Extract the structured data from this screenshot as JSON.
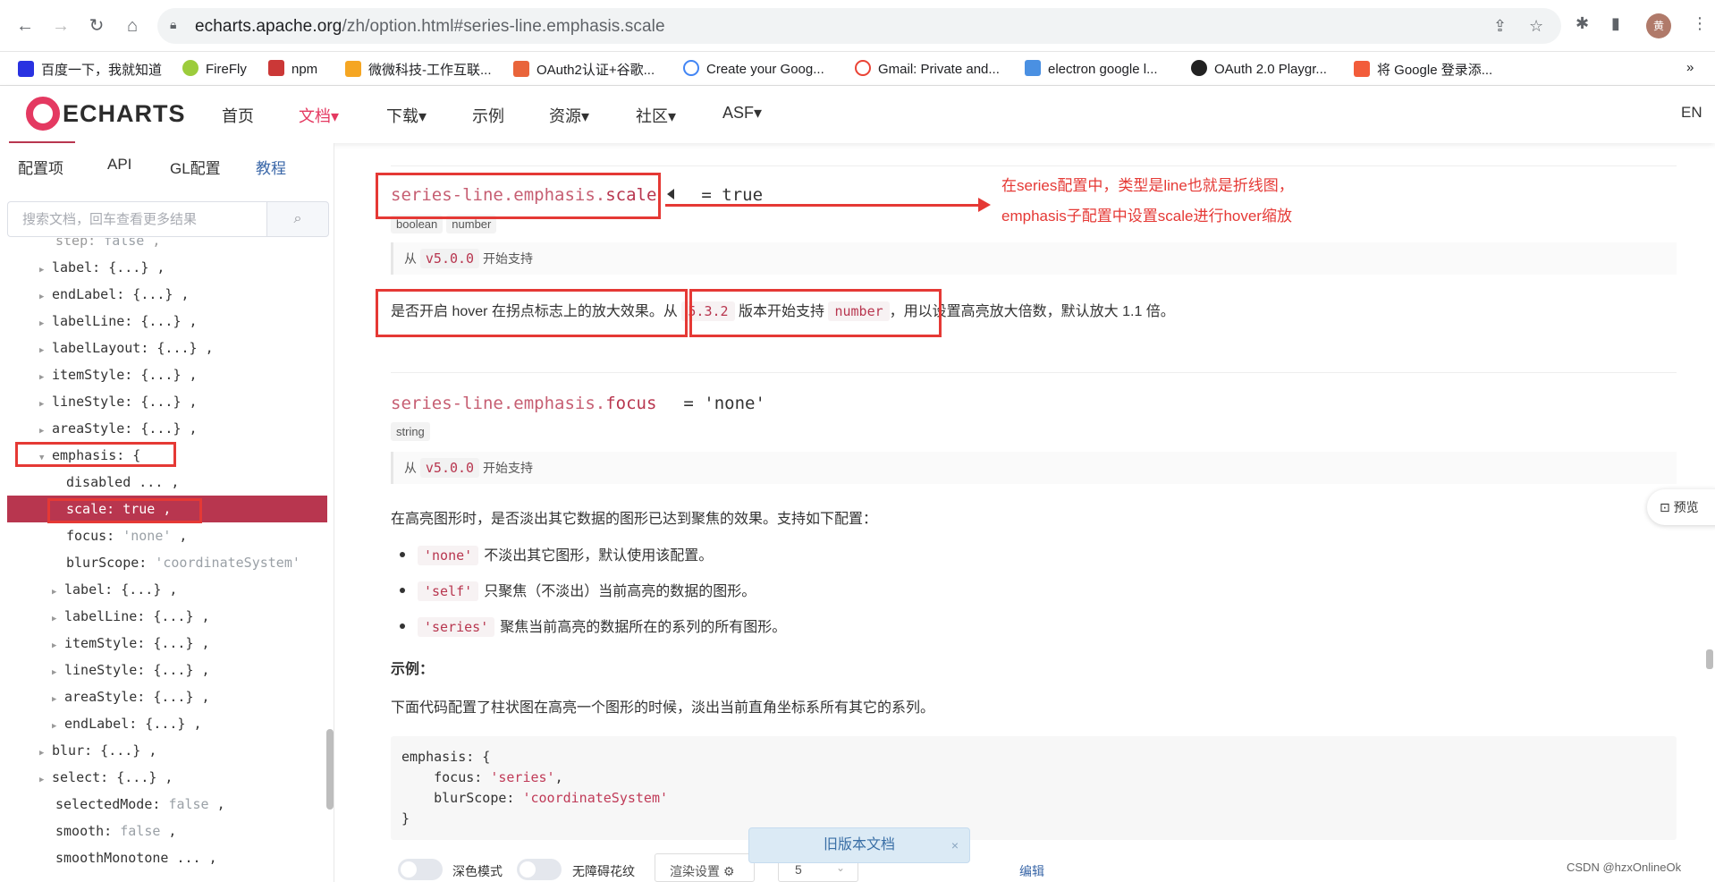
{
  "browser": {
    "url_host": "echarts.apache.org",
    "url_path": "/zh/option.html#series-line.emphasis.scale",
    "avatar_text": "黄",
    "bookmarks": [
      "百度一下，我就知道",
      "FireFly",
      "npm",
      "微微科技-工作互联...",
      "OAuth2认证+谷歌...",
      "Create your Goog...",
      "Gmail: Private and...",
      "electron google l...",
      "OAuth 2.0 Playgr...",
      "将 Google 登录添..."
    ],
    "bookmarks_more": "»"
  },
  "site": {
    "logo": "ECHARTS",
    "menu": [
      "首页",
      "文档▾",
      "下载▾",
      "示例",
      "资源▾",
      "社区▾",
      "ASF▾"
    ],
    "lang": "EN"
  },
  "sidebar": {
    "tabs": [
      "配置项",
      "API",
      "GL配置",
      "教程"
    ],
    "search_placeholder": "搜索文档，回车查看更多结果",
    "tree": [
      {
        "key": "step:",
        "val": "false",
        "tail": " ,"
      },
      {
        "key": "label:",
        "val": "",
        "tail": " {...} ,"
      },
      {
        "key": "endLabel:",
        "val": "",
        "tail": " {...} ,"
      },
      {
        "key": "labelLine:",
        "val": "",
        "tail": " {...} ,"
      },
      {
        "key": "labelLayout:",
        "val": "",
        "tail": " {...} ,"
      },
      {
        "key": "itemStyle:",
        "val": "",
        "tail": " {...} ,"
      },
      {
        "key": "lineStyle:",
        "val": "",
        "tail": " {...} ,"
      },
      {
        "key": "areaStyle:",
        "val": "",
        "tail": " {...} ,"
      },
      {
        "key": "emphasis:",
        "val": "",
        "tail": " {"
      },
      {
        "key": "disabled",
        "val": "",
        "tail": " ... ,"
      },
      {
        "key": "scale:",
        "val": "",
        "tail": " true ,"
      },
      {
        "key": "focus:",
        "val": "'none'",
        "tail": " ,"
      },
      {
        "key": "blurScope:",
        "val": "'coordinateSystem'",
        "tail": ""
      },
      {
        "key": "label:",
        "val": "",
        "tail": " {...} ,"
      },
      {
        "key": "labelLine:",
        "val": "",
        "tail": " {...} ,"
      },
      {
        "key": "itemStyle:",
        "val": "",
        "tail": " {...} ,"
      },
      {
        "key": "lineStyle:",
        "val": "",
        "tail": " {...} ,"
      },
      {
        "key": "areaStyle:",
        "val": "",
        "tail": " {...} ,"
      },
      {
        "key": "endLabel:",
        "val": "",
        "tail": " {...} ,"
      },
      {
        "key": "blur:",
        "val": "",
        "tail": " {...} ,"
      },
      {
        "key": "select:",
        "val": "",
        "tail": " {...} ,"
      },
      {
        "key": "selectedMode:",
        "val": "false",
        "tail": " ,"
      },
      {
        "key": "smooth:",
        "val": "false",
        "tail": " ,"
      },
      {
        "key": "smoothMonotone",
        "val": "",
        "tail": " ... ,"
      }
    ]
  },
  "scale_option": {
    "prefix": "series-line.emphasis.",
    "name": "scale",
    "default": "= true",
    "types": [
      "boolean",
      "number"
    ],
    "since_label": "从",
    "since_version": "v5.0.0",
    "since_suffix": "开始支持",
    "desc_part1": "是否开启 hover 在拐点标志上的放大效果。",
    "desc_part2": "从",
    "desc_version": "5.3.2",
    "desc_part3": "版本开始支持",
    "desc_code": "number",
    "desc_part4": "，用以设置高亮放大倍数，默认放大 1.1 倍。"
  },
  "annotation": {
    "line1": "在series配置中，类型是line也就是折线图，",
    "line2": "emphasis子配置中设置scale进行hover缩放"
  },
  "focus_option": {
    "prefix": "series-line.emphasis.",
    "name": "focus",
    "default": "= 'none'",
    "types": [
      "string"
    ],
    "since_label": "从",
    "since_version": "v5.0.0",
    "since_suffix": "开始支持",
    "desc": "在高亮图形时，是否淡出其它数据的图形已达到聚焦的效果。支持如下配置：",
    "bullets": [
      {
        "code": "'none'",
        "text": "不淡出其它图形，默认使用该配置。"
      },
      {
        "code": "'self'",
        "text": "只聚焦（不淡出）当前高亮的数据的图形。"
      },
      {
        "code": "'series'",
        "text": "聚焦当前高亮的数据所在的系列的所有图形。"
      }
    ],
    "example_title": "示例：",
    "example_desc": "下面代码配置了柱状图在高亮一个图形的时候，淡出当前直角坐标系所有其它的系列。",
    "code_line1": "emphasis: {",
    "code_line2_key": "    focus: ",
    "code_line2_val": "'series'",
    "code_line2_end": ",",
    "code_line3_key": "    blurScope: ",
    "code_line3_val": "'coordinateSystem'",
    "code_line4": "}"
  },
  "floating": {
    "preview": "预览",
    "old_docs": "旧版本文档",
    "close": "×"
  },
  "bottom_bar": {
    "dark_mode": "深色模式",
    "no_pattern": "无障碍花纹",
    "render_settings": "渲染设置",
    "count": "5",
    "edit": "编辑"
  },
  "watermark": "CSDN @hzxOnlineOk"
}
